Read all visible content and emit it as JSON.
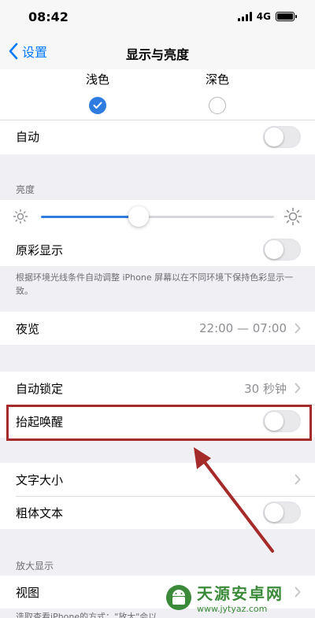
{
  "status_bar": {
    "time": "08:42",
    "network": "4G"
  },
  "nav": {
    "back_label": "设置",
    "title": "显示与亮度"
  },
  "appearance": {
    "light_label": "浅色",
    "dark_label": "深色",
    "selected": "light",
    "auto_label": "自动",
    "auto_enabled": false
  },
  "brightness": {
    "header": "亮度",
    "level": 0.42,
    "true_tone_label": "原彩显示",
    "true_tone_enabled": false,
    "true_tone_footer": "根据环境光线条件自动调整 iPhone 屏幕以在不同环境下保持色彩显示一致。"
  },
  "night_shift": {
    "label": "夜览",
    "value": "22:00 — 07:00"
  },
  "lock": {
    "auto_lock_label": "自动锁定",
    "auto_lock_value": "30 秒钟",
    "raise_to_wake_label": "抬起唤醒",
    "raise_to_wake_enabled": false
  },
  "text": {
    "text_size_label": "文字大小",
    "bold_text_label": "粗体文本",
    "bold_text_enabled": false
  },
  "zoom": {
    "header": "放大显示",
    "view_label": "视图",
    "footer_partial": "选取查看iPhone的方式：\"放大\"会以"
  },
  "watermark": {
    "title": "天源安卓网",
    "url": "www.jytyaz.com"
  },
  "colors": {
    "accent": "#2f7ce0",
    "highlight": "#a52a2a"
  }
}
